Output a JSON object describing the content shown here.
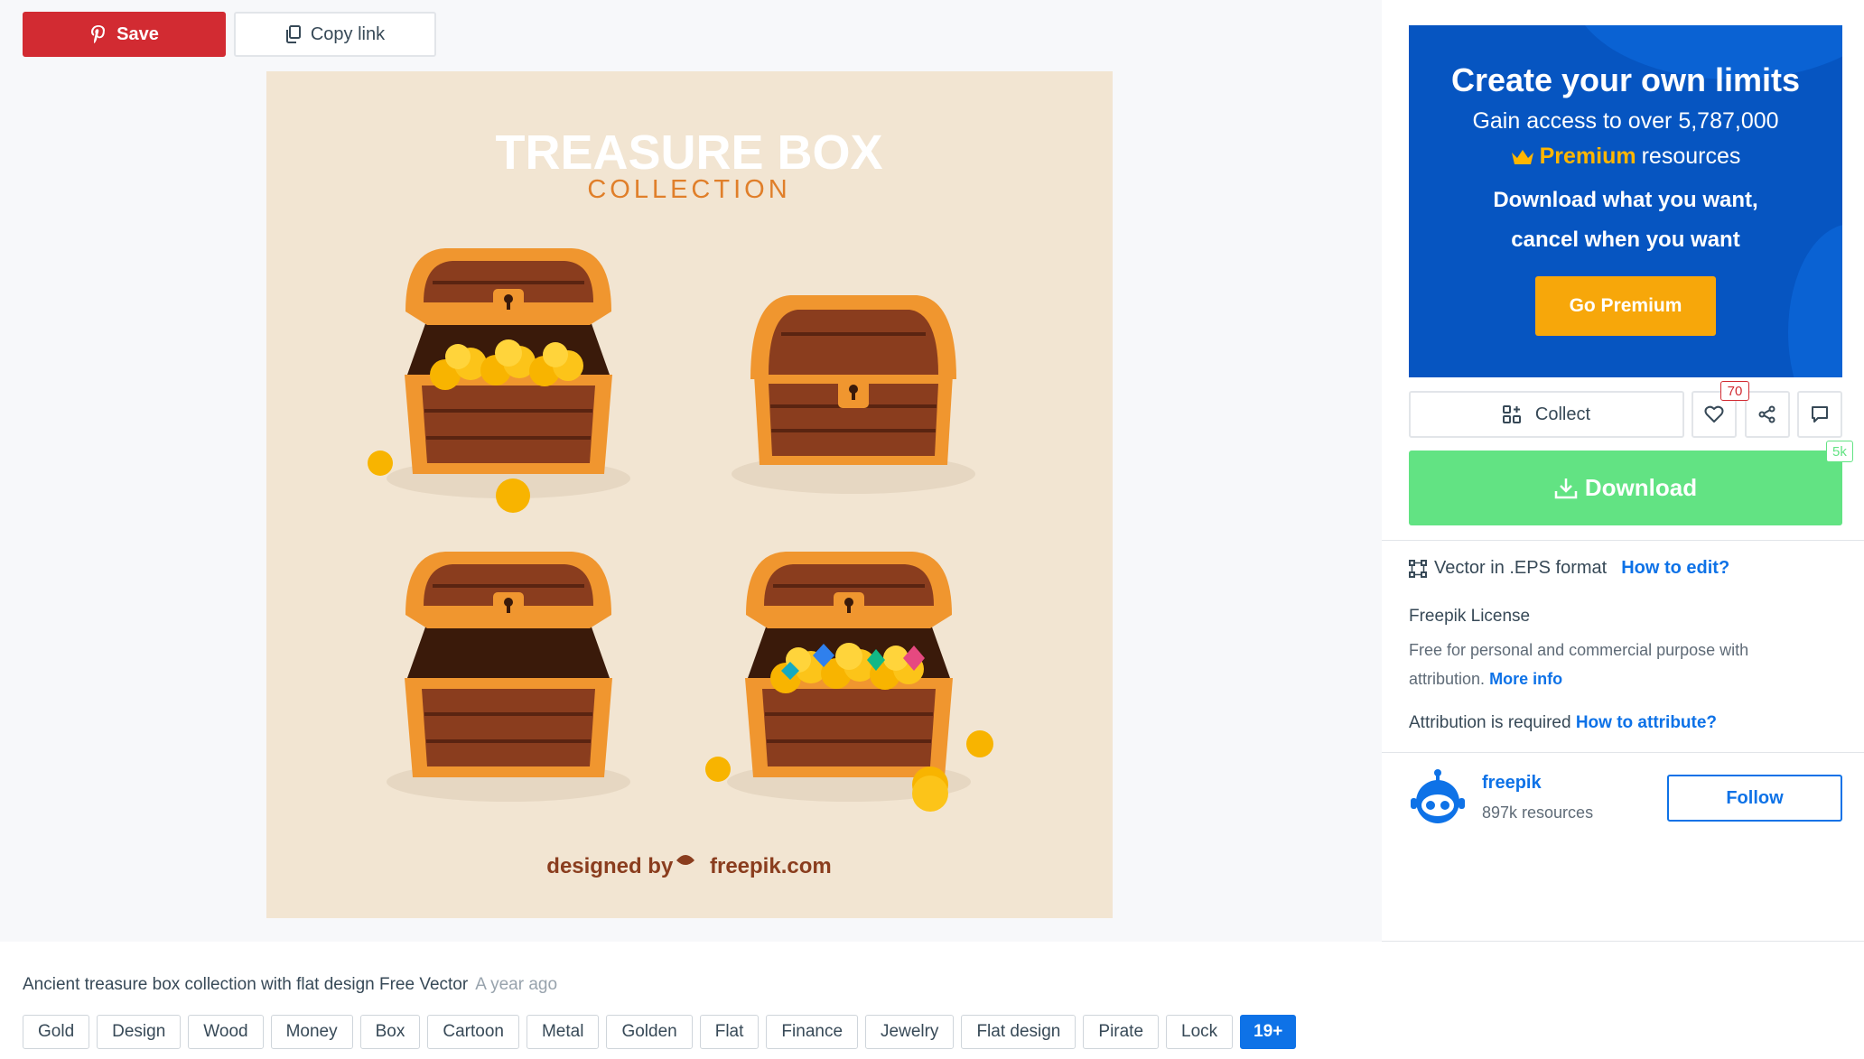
{
  "toolbar": {
    "save_label": "Save",
    "copy_label": "Copy link"
  },
  "preview": {
    "heading": "TREASURE BOX",
    "subheading": "COLLECTION",
    "credit_prefix": "designed by",
    "credit_site": "freepik.com"
  },
  "resource": {
    "title": "Ancient treasure box collection with flat design Free Vector",
    "time_ago": "A year ago"
  },
  "tags": [
    "Gold",
    "Design",
    "Wood",
    "Money",
    "Box",
    "Cartoon",
    "Metal",
    "Golden",
    "Flat",
    "Finance",
    "Jewelry",
    "Flat design",
    "Pirate",
    "Lock"
  ],
  "tags_more": "19+",
  "promo": {
    "title": "Create your own limits",
    "line1": "Gain access to over 5,787,000",
    "premium_word": "Premium",
    "premium_rest": "resources",
    "line3": "Download what you want,",
    "line4": "cancel when you want",
    "button": "Go Premium",
    "accent_color": "#0655c1",
    "button_color": "#f7a70a"
  },
  "actions": {
    "collect_label": "Collect",
    "like_count": "70"
  },
  "download": {
    "label": "Download",
    "count": "5k",
    "color": "#62e383"
  },
  "details": {
    "format_text": "Vector in .EPS format",
    "how_to_edit": "How to edit?",
    "license_title": "Freepik License",
    "license_desc": "Free for personal and commercial purpose with attribution.",
    "more_info": "More info",
    "attribution_text": "Attribution is required",
    "how_to_attribute": "How to attribute?"
  },
  "author": {
    "name": "freepik",
    "resources": "897k resources",
    "follow_label": "Follow"
  },
  "icons": {
    "save": "pinterest-icon",
    "copy": "copy-icon",
    "collect": "collect-icon",
    "like": "heart-icon",
    "share": "share-icon",
    "comment": "comment-icon",
    "download": "download-icon",
    "format": "vector-format-icon",
    "crown": "crown-icon"
  }
}
